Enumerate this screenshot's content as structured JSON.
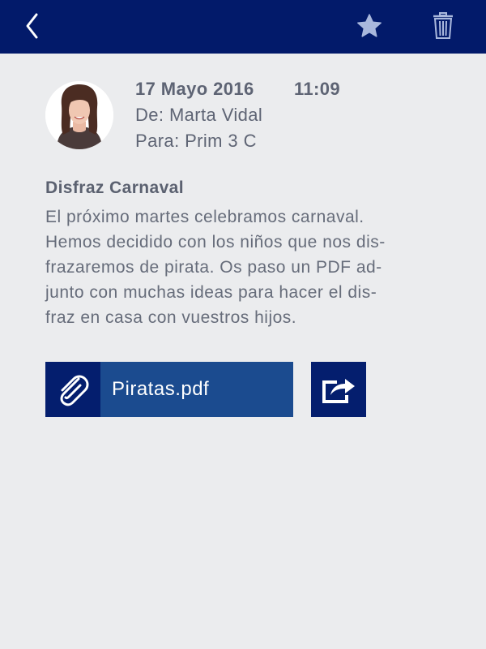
{
  "header": {
    "back_icon": "chevron-left-icon",
    "star_icon": "star-icon",
    "trash_icon": "trash-icon"
  },
  "message": {
    "date": "17 Mayo 2016",
    "time": "11:09",
    "from": "De: Marta Vidal",
    "to": "Para: Prim 3 C",
    "subject": "Disfraz Carnaval",
    "body_lines": [
      "El próximo martes celebramos carnaval.",
      "Hemos decidido con los niños que nos dis-",
      "frazaremos de pirata. Os paso un PDF ad-",
      "junto con muchas ideas para hacer el dis-",
      "fraz en casa con vuestros hijos."
    ]
  },
  "attachment": {
    "filename": "Piratas.pdf",
    "icon": "paperclip-icon"
  },
  "share": {
    "icon": "share-icon"
  },
  "colors": {
    "topbar": "#021a6a",
    "background": "#ebecee",
    "attachment": "#1b4b8f",
    "icon_box": "#041e6e"
  }
}
